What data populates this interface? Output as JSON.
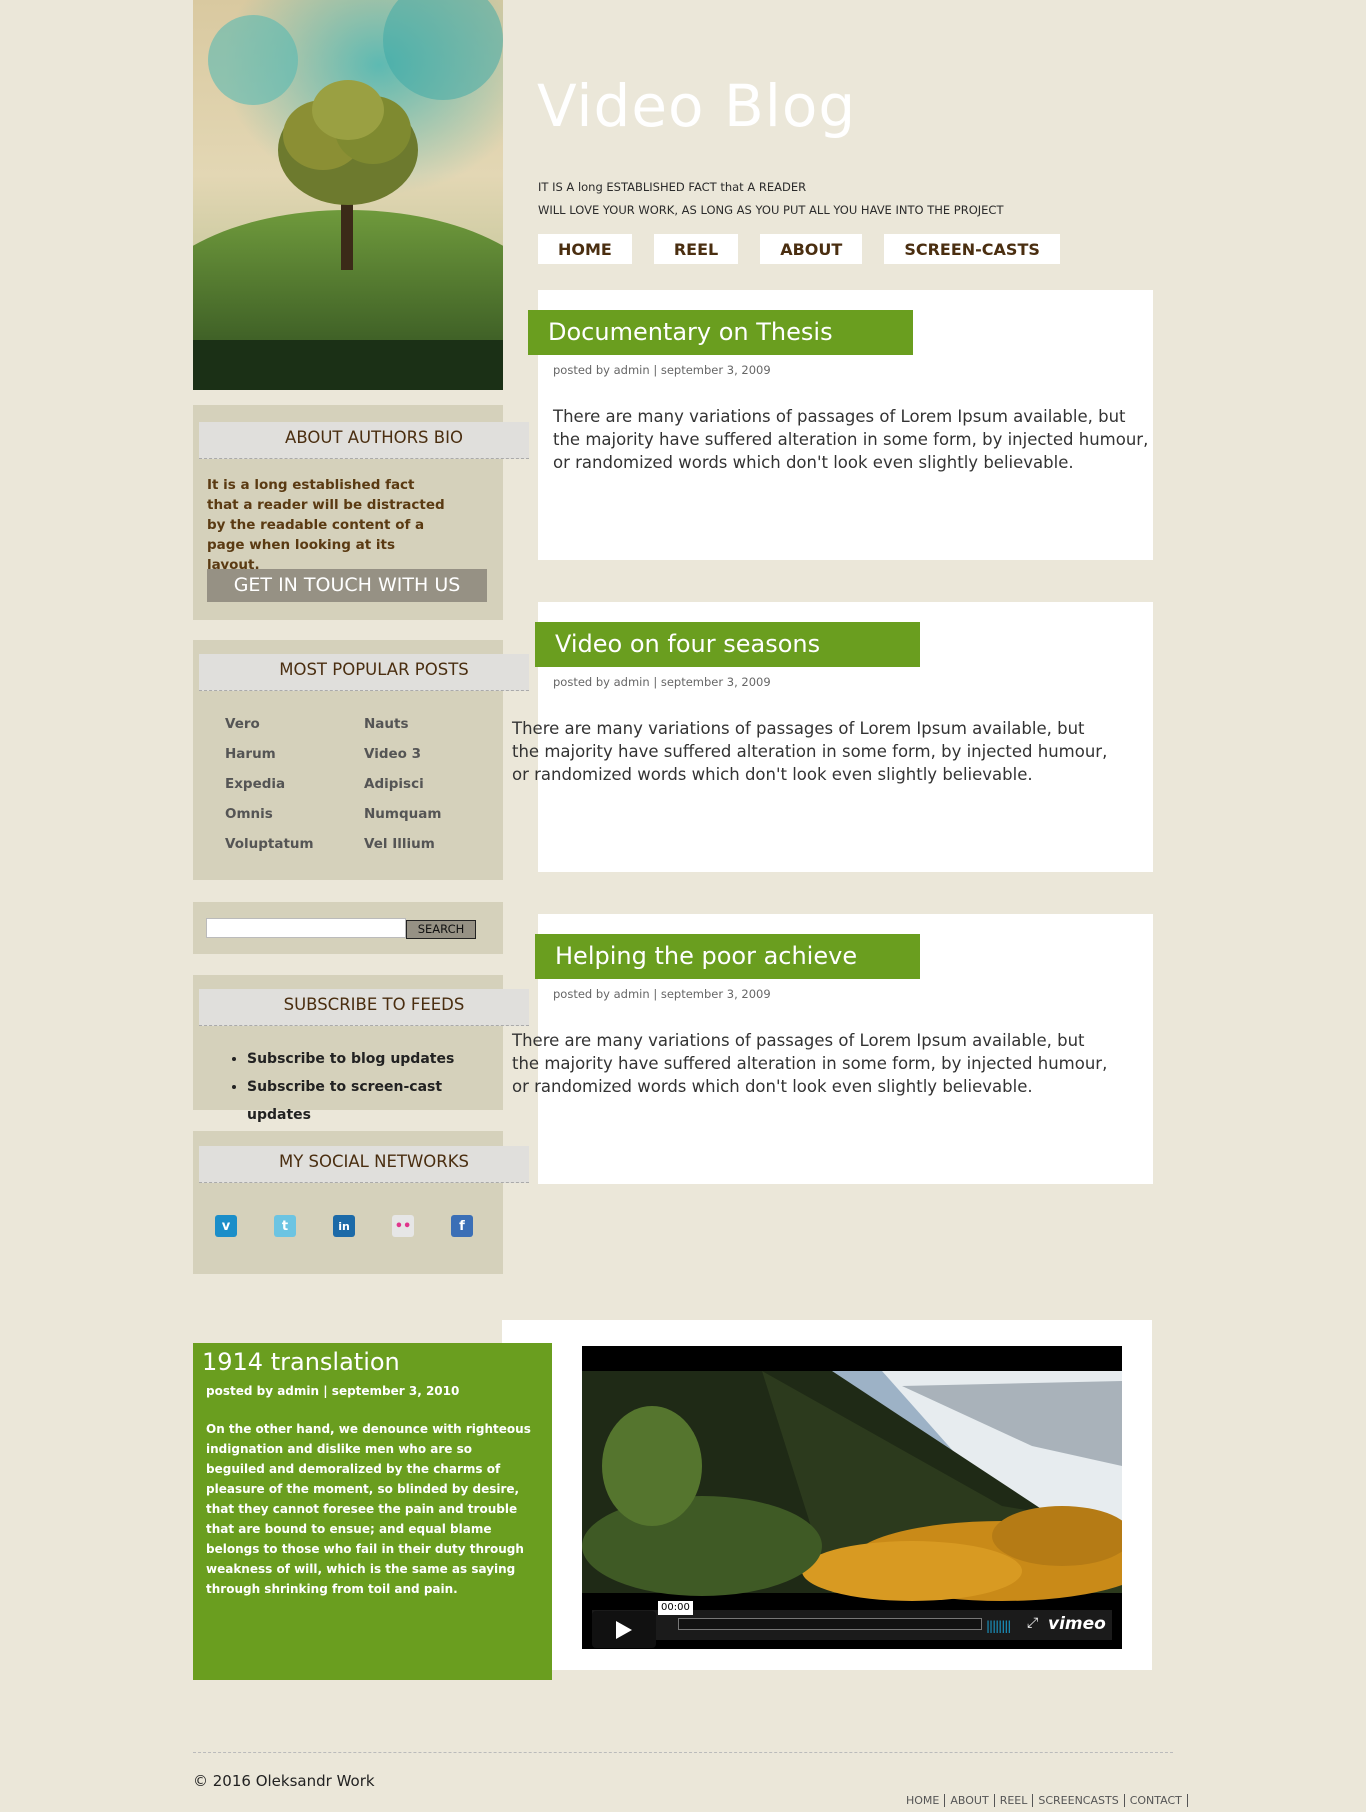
{
  "site": {
    "title": "Video Blog",
    "tagline_line1": "IT IS A long ESTABLISHED FACT that A READER",
    "tagline_line2": "WILL LOVE YOUR WORK, AS LONG AS YOU PUT ALL YOU HAVE INTO THE PROJECT"
  },
  "nav": {
    "home": "HOME",
    "reel": "REEL",
    "about": "ABOUT",
    "screencasts": "SCREEN-CASTS"
  },
  "sidebar": {
    "about_heading": "ABOUT AUTHORS BIO",
    "about_text": "It is a long established fact that a reader will be distracted by the readable content of a page when looking at its layout.",
    "contact_button": "GET IN TOUCH WITH US",
    "popular_heading": "MOST POPULAR POSTS",
    "popular_posts": [
      "Vero",
      "Nauts",
      "Harum",
      "Video 3",
      "Expedia",
      "Adipisci",
      "Omnis",
      "Numquam",
      "Voluptatum",
      "Vel Illium"
    ],
    "search_button": "SEARCH",
    "search_value": "",
    "subscribe_heading": "SUBSCRIBE TO FEEDS",
    "subscribe_items": [
      "Subscribe to blog updates",
      "Subscribe to screen-cast updates"
    ],
    "social_heading": "MY SOCIAL NETWORKS",
    "social_icons": [
      {
        "name": "vimeo-icon",
        "glyph": "v",
        "color": "#1b8ec9"
      },
      {
        "name": "twitter-icon",
        "glyph": "t",
        "color": "#6cc4e2"
      },
      {
        "name": "linkedin-icon",
        "glyph": "in",
        "color": "#1c6aa8"
      },
      {
        "name": "flickr-icon",
        "glyph": "••",
        "color": "#e6e6e6"
      },
      {
        "name": "facebook-icon",
        "glyph": "f",
        "color": "#3b6fb6"
      }
    ]
  },
  "posts": [
    {
      "title": "Documentary on Thesis",
      "meta": "posted by admin | september 3, 2009",
      "body": "There are many variations of passages of Lorem Ipsum available, but the majority have suffered alteration in some form, by injected humour, or randomized words which don't look even slightly believable."
    },
    {
      "title": "Video on four seasons",
      "meta": "posted by admin | september 3, 2009",
      "body": "There are many variations of passages of Lorem Ipsum available, but the majority have suffered alteration in some form, by injected humour, or randomized words which don't look even slightly believable."
    },
    {
      "title": "Helping the poor achieve",
      "meta": "posted by admin | september 3, 2009",
      "body": "There are many variations of passages of Lorem Ipsum available, but the majority have suffered alteration in some form, by injected humour, or randomized words which don't look even slightly believable."
    }
  ],
  "feature": {
    "title": "1914 translation",
    "meta": "posted by admin | september 3, 2010",
    "text": "On the other hand, we denounce with righteous indignation and dislike men who are so beguiled and demoralized by the charms of pleasure of the moment, so blinded by desire, that they cannot foresee the pain and trouble that are bound to ensue; and equal blame belongs to those who fail in their duty through weakness of will, which is the same as saying through shrinking from toil and pain.",
    "video": {
      "time": "00:00",
      "logo": "vimeo"
    }
  },
  "footer": {
    "copyright": "© 2016 Oleksandr Work",
    "links": [
      "HOME",
      "ABOUT",
      "REEL",
      "SCREENCASTS",
      "CONTACT"
    ]
  },
  "colors": {
    "accent_green": "#6a9e1f",
    "page_bg": "#ebe7d9",
    "sidebar_bg": "#d5d1bb",
    "nav_text": "#4a2e10"
  }
}
